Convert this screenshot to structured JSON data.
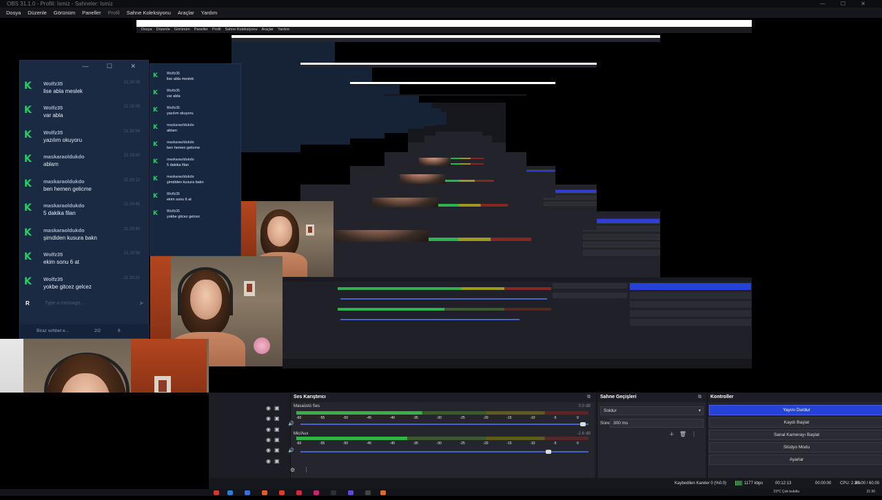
{
  "window": {
    "title": "OBS 31.1.0 - Profili: Ismiz - Sahneler: Ismiz",
    "controls": "— ☐ ✕"
  },
  "menu": {
    "items": [
      "Dosya",
      "Düzenle",
      "Görünüm",
      "Paneller",
      "Profil",
      "Sahne Koleksiyonu",
      "Araçlar",
      "Yardım"
    ]
  },
  "chat": {
    "window_controls": "— ☐ ✕",
    "messages": [
      {
        "user": "Wolfz35",
        "time": "21:28:16",
        "text": "lise abla meslek"
      },
      {
        "user": "Wolfz35",
        "time": "21:28:28",
        "text": "var abla"
      },
      {
        "user": "Wolfz35",
        "time": "21:28:34",
        "text": "yazılım okuyoru"
      },
      {
        "user": "maskaraoldukdo",
        "time": "21:28:40",
        "text": "ablam"
      },
      {
        "user": "maskaraoldukdo",
        "time": "21:29:12",
        "text": "ben hemen gelicme"
      },
      {
        "user": "maskaraoldukdo",
        "time": "21:29:45",
        "text": "5 dakika filan"
      },
      {
        "user": "maskaraoldukdo",
        "time": "21:29:49",
        "text": "şimdiden kusura bakn"
      },
      {
        "user": "Wolfz35",
        "time": "21:29:56",
        "text": "ekim sonu 6 at"
      },
      {
        "user": "Wolfz35",
        "time": "21:30:21",
        "text": "yokbe gitcez gelcez"
      }
    ],
    "input_placeholder": "Type a message...",
    "input_r": "R",
    "send_icon": "➤",
    "footer_label": "Biraz sohbet e...",
    "footer_count": "2/2",
    "footer_viewers": "6"
  },
  "mixer": {
    "title": "Ses Karıştırıcı",
    "tracks": [
      {
        "name": "Masaüstü Ses",
        "db": "0.0 dB",
        "level": 0.43,
        "volume": 0.99
      },
      {
        "name": "Mic/Aux",
        "db": "-2.6 dB",
        "level": 0.38,
        "volume": 0.87
      }
    ],
    "scale": [
      "-60",
      "-55",
      "-50",
      "-45",
      "-40",
      "-35",
      "-30",
      "-25",
      "-20",
      "-15",
      "-10",
      "-5",
      "0"
    ]
  },
  "transitions": {
    "title": "Sahne Geçişleri",
    "selected": "Soldur",
    "duration_label": "Süre",
    "duration_value": "300 ms"
  },
  "controls": {
    "title": "Kontroller",
    "buttons": [
      "Yayını Durdur",
      "Kaydı Başlat",
      "Sanal Kamerayı Başlat",
      "Stüdyo Modu",
      "Ayarlar"
    ]
  },
  "status": {
    "dropped": "Kaybedilen Kareler 0 (%0.0)",
    "bitrate": "1177 kbps",
    "stream_time": "00:12:13",
    "rec_time": "00:00:00",
    "cpu": "CPU: 2.3%",
    "fps": "60.00 / 60.00 FPS"
  },
  "taskbar": {
    "weather": "23°C Çok bulutlu",
    "clock": "21:30"
  },
  "colors": {
    "accent": "#2443d6",
    "chat_bg": "#1a2a42",
    "kick_green": "#23d160",
    "meter_green": "#2fb34a"
  }
}
